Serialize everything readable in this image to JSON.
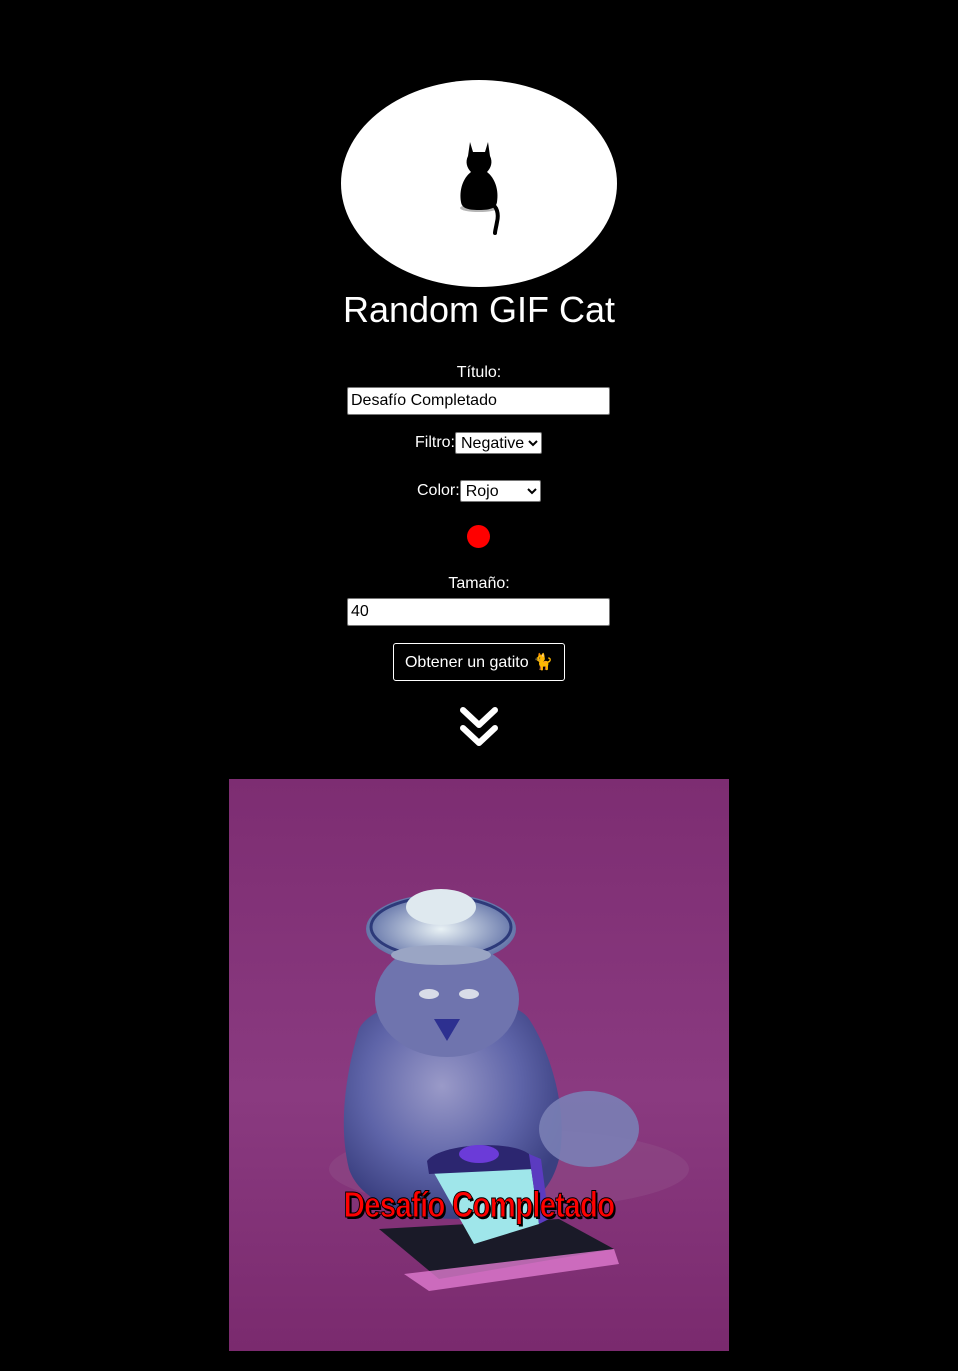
{
  "app": {
    "title": "Random GIF Cat",
    "logo_icon": "cat-silhouette-icon"
  },
  "form": {
    "title_label": "Título:",
    "title_value": "Desafío Completado",
    "filter_label": "Filtro:",
    "filter_selected": "Negative",
    "color_label": "Color:",
    "color_selected": "Rojo",
    "color_preview": "#ff0000",
    "size_label": "Tamaño:",
    "size_value": "40",
    "submit_label": "Obtener un gatito 🐈",
    "scroll_icon": "double-chevron-down-icon"
  },
  "result": {
    "caption": "Desafío Completado",
    "caption_color": "#ff0000",
    "filter_applied": "Negative"
  },
  "colors": {
    "background": "#000000",
    "text": "#ffffff",
    "gif_background": "#7d2d72"
  }
}
